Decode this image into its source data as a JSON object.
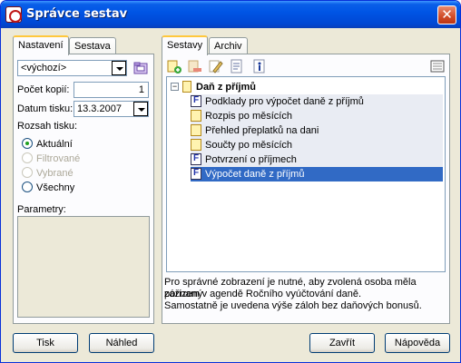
{
  "window": {
    "title": "Správce sestav",
    "close_symbol": "✕"
  },
  "left_tabs": [
    {
      "label": "Nastavení",
      "active": true
    },
    {
      "label": "Sestava",
      "active": false
    }
  ],
  "settings": {
    "preset_value": "<výchozí>",
    "copies_label": "Počet kopií:",
    "copies_value": "1",
    "date_label": "Datum tisku:",
    "date_value": "13.3.2007",
    "range_label": "Rozsah tisku:",
    "range_options": [
      {
        "label": "Aktuální",
        "checked": true,
        "disabled": false
      },
      {
        "label": "Filtrované",
        "checked": false,
        "disabled": true
      },
      {
        "label": "Vybrané",
        "checked": false,
        "disabled": true
      },
      {
        "label": "Všechny",
        "checked": false,
        "disabled": false
      }
    ],
    "params_label": "Parametry:"
  },
  "right_tabs": [
    {
      "label": "Sestavy",
      "active": true
    },
    {
      "label": "Archiv",
      "active": false
    }
  ],
  "toolbar_icons": [
    "add-report-icon",
    "delete-report-icon",
    "edit-report-icon",
    "properties-icon",
    "info-icon",
    "view-options-icon"
  ],
  "tree": {
    "root": "Daň z příjmů",
    "items": [
      {
        "label": "Podklady pro výpočet daně z příjmů",
        "icon": "form-icon",
        "selected": false
      },
      {
        "label": "Rozpis po měsících",
        "icon": "report-icon",
        "selected": false
      },
      {
        "label": "Přehled přeplatků na dani",
        "icon": "report-icon",
        "selected": false
      },
      {
        "label": "Součty po měsících",
        "icon": "report-icon",
        "selected": false
      },
      {
        "label": "Potvrzení o příjmech",
        "icon": "form-icon",
        "selected": false
      },
      {
        "label": "Výpočet daně z příjmů",
        "icon": "form-icon",
        "selected": true
      }
    ]
  },
  "info": {
    "line1": "Pro správné zobrazení je nutné, aby zvolená osoba měla pořízený",
    "line2": "záznam v agendě Ročního vyúčtování daně.",
    "line3": "Samostatně je uvedena výše záloh bez daňových bonusů."
  },
  "buttons": {
    "print": "Tisk",
    "preview": "Náhled",
    "close": "Zavřít",
    "help": "Nápověda"
  },
  "colors": {
    "titlebar": "#0055e5",
    "selection": "#316ac5",
    "tab_highlight": "#ffc83c"
  }
}
